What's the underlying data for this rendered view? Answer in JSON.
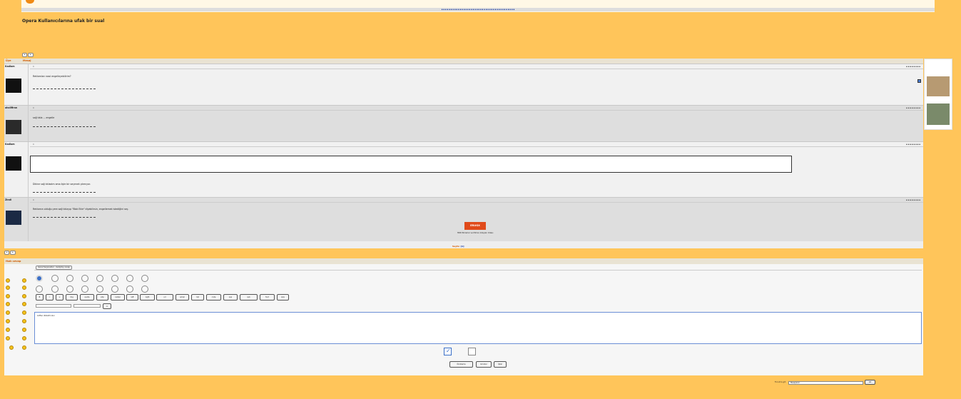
{
  "topic": {
    "title": "Opera Kullanıcılarına ufak bir sual"
  },
  "thread_header": {
    "author_col": "Üye",
    "message_col": "Mesaj"
  },
  "pagination": {
    "label": "Sayfa:",
    "pages": "[1]"
  },
  "posts": [
    {
      "username": "Kadium",
      "message": "Reklamları nasıl engelleyebilirim?"
    },
    {
      "username": "ahalifiran",
      "message": "sağ tıkla ... engelle"
    },
    {
      "username": "Kadium",
      "message": "Dikine sağ tıkladım ama öyle bir seçenek çıkmıyor."
    },
    {
      "username": "Zindi",
      "message": "Reklamın olduğu yere sağ tıklayıp \"Blok Ekle\" diyebilirsin, engellemek istediğini seç."
    }
  ],
  "signature": {
    "badge": "ERUGX",
    "line": "HDR Mimarlar ve Mimar Adayları Odası"
  },
  "reply": {
    "header": "Hızlı cevap",
    "tab_label": "Genel Seçenekler - Gelişmiş cevap",
    "buttons": [
      "B",
      "i",
      "u",
      "img",
      "quote",
      "php",
      "center",
      "left",
      "right",
      "url",
      "email",
      "list",
      "code",
      "sup",
      "sub",
      "font",
      "size",
      "color"
    ],
    "textarea_text": "Lütfen dikkatli olun",
    "preview_label": "Önizleme",
    "post_label": "Gönder",
    "cancel_label": "İptal"
  },
  "jump": {
    "label": "Forum'a git:",
    "selected": "Mesajlarım",
    "go_label": "Git"
  }
}
